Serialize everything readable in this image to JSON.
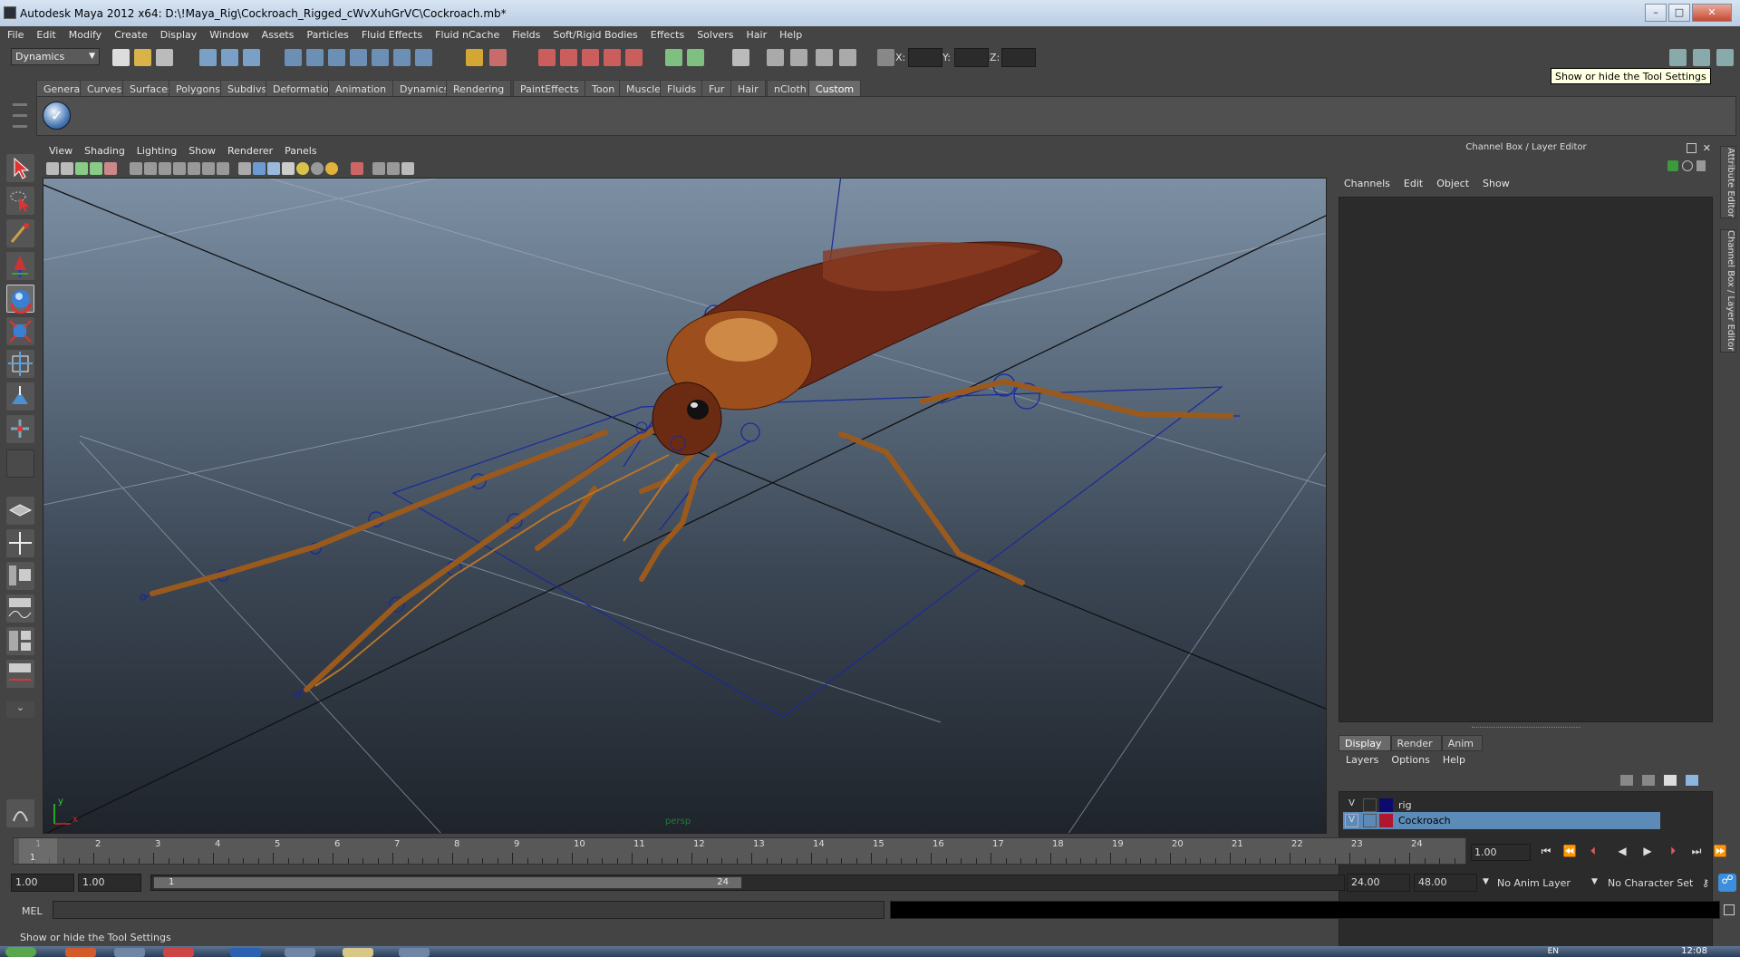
{
  "window": {
    "title": "Autodesk Maya 2012 x64: D:\\!Maya_Rig\\Cockroach_Rigged_cWvXuhGrVC\\Cockroach.mb*",
    "min_icon": "minimize-icon",
    "max_icon": "maximize-icon",
    "close_icon": "close-icon"
  },
  "menubar": [
    "File",
    "Edit",
    "Modify",
    "Create",
    "Display",
    "Window",
    "Assets",
    "Particles",
    "Fluid Effects",
    "Fluid nCache",
    "Fields",
    "Soft/Rigid Bodies",
    "Effects",
    "Solvers",
    "Hair",
    "Help"
  ],
  "statusline": {
    "mode": "Dynamics",
    "x_label": "X:",
    "y_label": "Y:",
    "z_label": "Z:"
  },
  "tooltip": "Show or hide the Tool Settings",
  "shelf": {
    "tabs": [
      "General",
      "Curves",
      "Surfaces",
      "Polygons",
      "Subdivs",
      "Deformation",
      "Animation",
      "Dynamics",
      "Rendering",
      "PaintEffects",
      "Toon",
      "Muscle",
      "Fluids",
      "Fur",
      "Hair",
      "nCloth",
      "Custom"
    ],
    "active_tab": "Custom"
  },
  "panel": {
    "menu": [
      "View",
      "Shading",
      "Lighting",
      "Show",
      "Renderer",
      "Panels"
    ],
    "camera": "persp",
    "axis_x": "x",
    "axis_y": "y"
  },
  "channel_box": {
    "title": "Channel Box / Layer Editor",
    "menu": [
      "Channels",
      "Edit",
      "Object",
      "Show"
    ]
  },
  "layer_editor": {
    "tabs": [
      "Display",
      "Render",
      "Anim"
    ],
    "active_tab": "Display",
    "menu": [
      "Layers",
      "Options",
      "Help"
    ],
    "layers": [
      {
        "visible": "V",
        "name": "rig",
        "color": "#0b0b6e",
        "selected": false
      },
      {
        "visible": "V",
        "name": "Cockroach",
        "color": "#b0162f",
        "selected": true
      }
    ]
  },
  "side_tabs": [
    "Attribute Editor",
    "Channel Box / Layer Editor"
  ],
  "time_slider": {
    "ticks": [
      "1",
      "2",
      "3",
      "4",
      "5",
      "6",
      "7",
      "8",
      "9",
      "10",
      "11",
      "12",
      "13",
      "14",
      "15",
      "16",
      "17",
      "18",
      "19",
      "20",
      "21",
      "22",
      "23",
      "24"
    ],
    "current_marker": "1",
    "current_frame": "1.00"
  },
  "range_slider": {
    "start_time": "1.00",
    "playback_start": "1.00",
    "range_start_label": "1",
    "range_end_label": "24",
    "playback_end": "24.00",
    "end_time": "48.00",
    "anim_layer": "No Anim Layer",
    "character_set": "No Character Set"
  },
  "command_line": {
    "label": "MEL"
  },
  "help_line": "Show or hide the Tool Settings",
  "taskbar": {
    "lang": "EN",
    "clock": "12:08"
  }
}
